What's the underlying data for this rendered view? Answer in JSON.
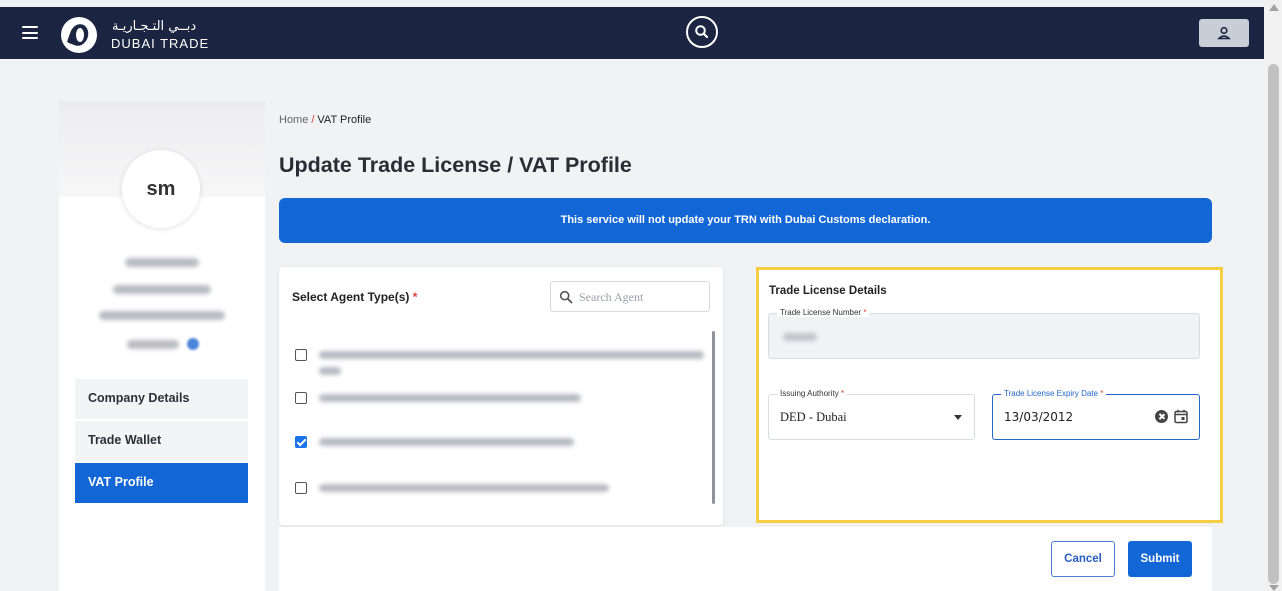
{
  "header": {
    "logo_arabic": "دبــي التـجـاريـة",
    "logo_english": "DUBAI TRADE",
    "menu_icon": "hamburger-menu-icon",
    "search_icon": "search-icon",
    "user_icon": "user-icon"
  },
  "sidebar": {
    "avatar_initials": "sm",
    "nav_items": [
      {
        "label": "Company Details",
        "active": false
      },
      {
        "label": "Trade Wallet",
        "active": false
      },
      {
        "label": "VAT Profile",
        "active": true
      }
    ]
  },
  "breadcrumb": {
    "home": "Home",
    "separator": "/",
    "current": "VAT Profile"
  },
  "page_title": "Update Trade License / VAT Profile",
  "notice": "This service will not update your TRN with Dubai Customs declaration.",
  "agent_panel": {
    "label": "Select Agent Type(s)",
    "required_mark": "*",
    "search_placeholder": "Search Agent",
    "agents": [
      {
        "checked": false
      },
      {
        "checked": false
      },
      {
        "checked": true
      },
      {
        "checked": false
      }
    ]
  },
  "trade_license": {
    "section_title": "Trade License Details",
    "license_number_label": "Trade License Number",
    "issuing_authority_label": "Issuing Authority",
    "issuing_authority_value": "DED - Dubai",
    "expiry_date_label": "Trade License Expiry Date",
    "expiry_date_value": "13/03/2012",
    "required_mark": "*"
  },
  "actions": {
    "cancel": "Cancel",
    "submit": "Submit"
  },
  "colors": {
    "header_bg": "#1b2541",
    "primary": "#1366d6",
    "highlight": "#f6ce42",
    "required": "#e03c31"
  }
}
